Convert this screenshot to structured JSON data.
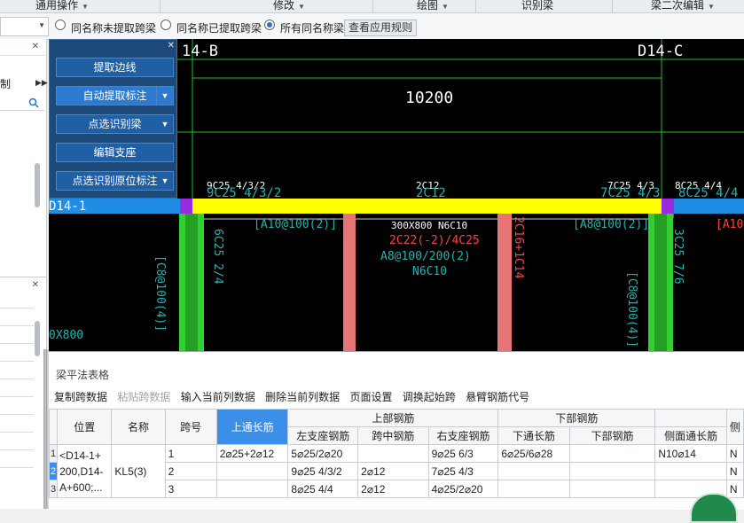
{
  "menubar": {
    "items": [
      {
        "label": "通用操作"
      },
      {
        "label": "修改"
      },
      {
        "label": "绘图"
      },
      {
        "label": "识别梁"
      },
      {
        "label": "梁二次编辑"
      }
    ]
  },
  "options": {
    "radio1": "同名称未提取跨梁",
    "radio2": "同名称已提取跨梁",
    "radio3": "所有同名称梁",
    "selected": "所有同名称梁",
    "apply_button": "查看应用规则"
  },
  "left_panel": {
    "item_text": "制"
  },
  "tool_panel": {
    "buttons": [
      {
        "label": "提取边线"
      },
      {
        "label": "自动提取标注"
      },
      {
        "label": "点选识别梁"
      },
      {
        "label": "编辑支座"
      },
      {
        "label": "点选识别原位标注"
      }
    ]
  },
  "cad": {
    "axis_left": "14-B",
    "axis_right": "D14-C",
    "dimension": "10200",
    "beam_label": "D14-1",
    "ann": {
      "top_left_white": "9C25 4/3/2",
      "top_left_cyan": "9C25 4/3/2",
      "top_mid_white": "2C12",
      "top_mid_cyan": "2C12",
      "top_right_white": "7C25 4/3",
      "top_right_cyan": "7C25 4/3",
      "top_far_white": "8C25 4/4",
      "top_far_cyan": "8C25 4/4",
      "stir_left": "[A10@100(2)]",
      "stir_right": "[A8@100(2)]",
      "stir_far": "[A10",
      "beam_spec": "300X800 N6C10",
      "bottom_red": "2C22(-2)/4C25",
      "stirrup": "A8@100/200(2)",
      "waist": "N6C10",
      "col_left1": "6C25 2/4",
      "col_left2": "[C8@100(4)]",
      "col_right1": "3C25 7/6",
      "col_right2": "[C8@100(4)]",
      "mid_red": "2C16+1C14",
      "x800": "0X800"
    }
  },
  "table": {
    "title": "梁平法表格",
    "toolbar": [
      {
        "label": "复制跨数据",
        "disabled": false
      },
      {
        "label": "粘贴跨数据",
        "disabled": true
      },
      {
        "label": "输入当前列数据",
        "disabled": false
      },
      {
        "label": "删除当前列数据",
        "disabled": false
      },
      {
        "label": "页面设置",
        "disabled": false
      },
      {
        "label": "调换起始跨",
        "disabled": false
      },
      {
        "label": "悬臂钢筋代号",
        "disabled": false
      }
    ],
    "headers": {
      "position": "位置",
      "name": "名称",
      "span": "跨号",
      "top_through": "上通长筋",
      "top_group": "上部钢筋",
      "left_support": "左支座钢筋",
      "mid_span": "跨中钢筋",
      "right_support": "右支座钢筋",
      "bottom_group": "下部钢筋",
      "bottom_through": "下通长筋",
      "bottom_bars": "下部钢筋",
      "side_through": "侧面通长筋",
      "extra": "侧"
    },
    "position_value": "<D14-1+200,D14-A+600;...",
    "position_lines": [
      "<D14-1+",
      "200,D14-",
      "A+600;..."
    ],
    "name_value": "KL5(3)",
    "rows": [
      {
        "num": "1",
        "span": "1",
        "top_through": "2⌀25+2⌀12",
        "left": "5⌀25/2⌀20",
        "mid": "",
        "right": "9⌀25 6/3",
        "bottom_through": "6⌀25/6⌀28",
        "bottom": "",
        "side": "N10⌀14",
        "extra": "N"
      },
      {
        "num": "2",
        "span": "2",
        "top_through": "",
        "left": "9⌀25 4/3/2",
        "mid": "2⌀12",
        "right": "7⌀25 4/3",
        "bottom_through": "",
        "bottom": "",
        "side": "",
        "extra": "N"
      },
      {
        "num": "3",
        "span": "3",
        "top_through": "",
        "left": "8⌀25 4/4",
        "mid": "2⌀12",
        "right": "4⌀25/2⌀20",
        "bottom_through": "",
        "bottom": "",
        "side": "",
        "extra": "N"
      }
    ]
  },
  "colors": {
    "beam_band": "#1f8de6",
    "beam_yellow": "#ffff00",
    "column_green": "#2fd02f",
    "column_pink": "#e87575",
    "cad_cyan": "#1fb3b3",
    "cad_red": "#ff4040",
    "panel_blue": "#1e4a7a"
  }
}
